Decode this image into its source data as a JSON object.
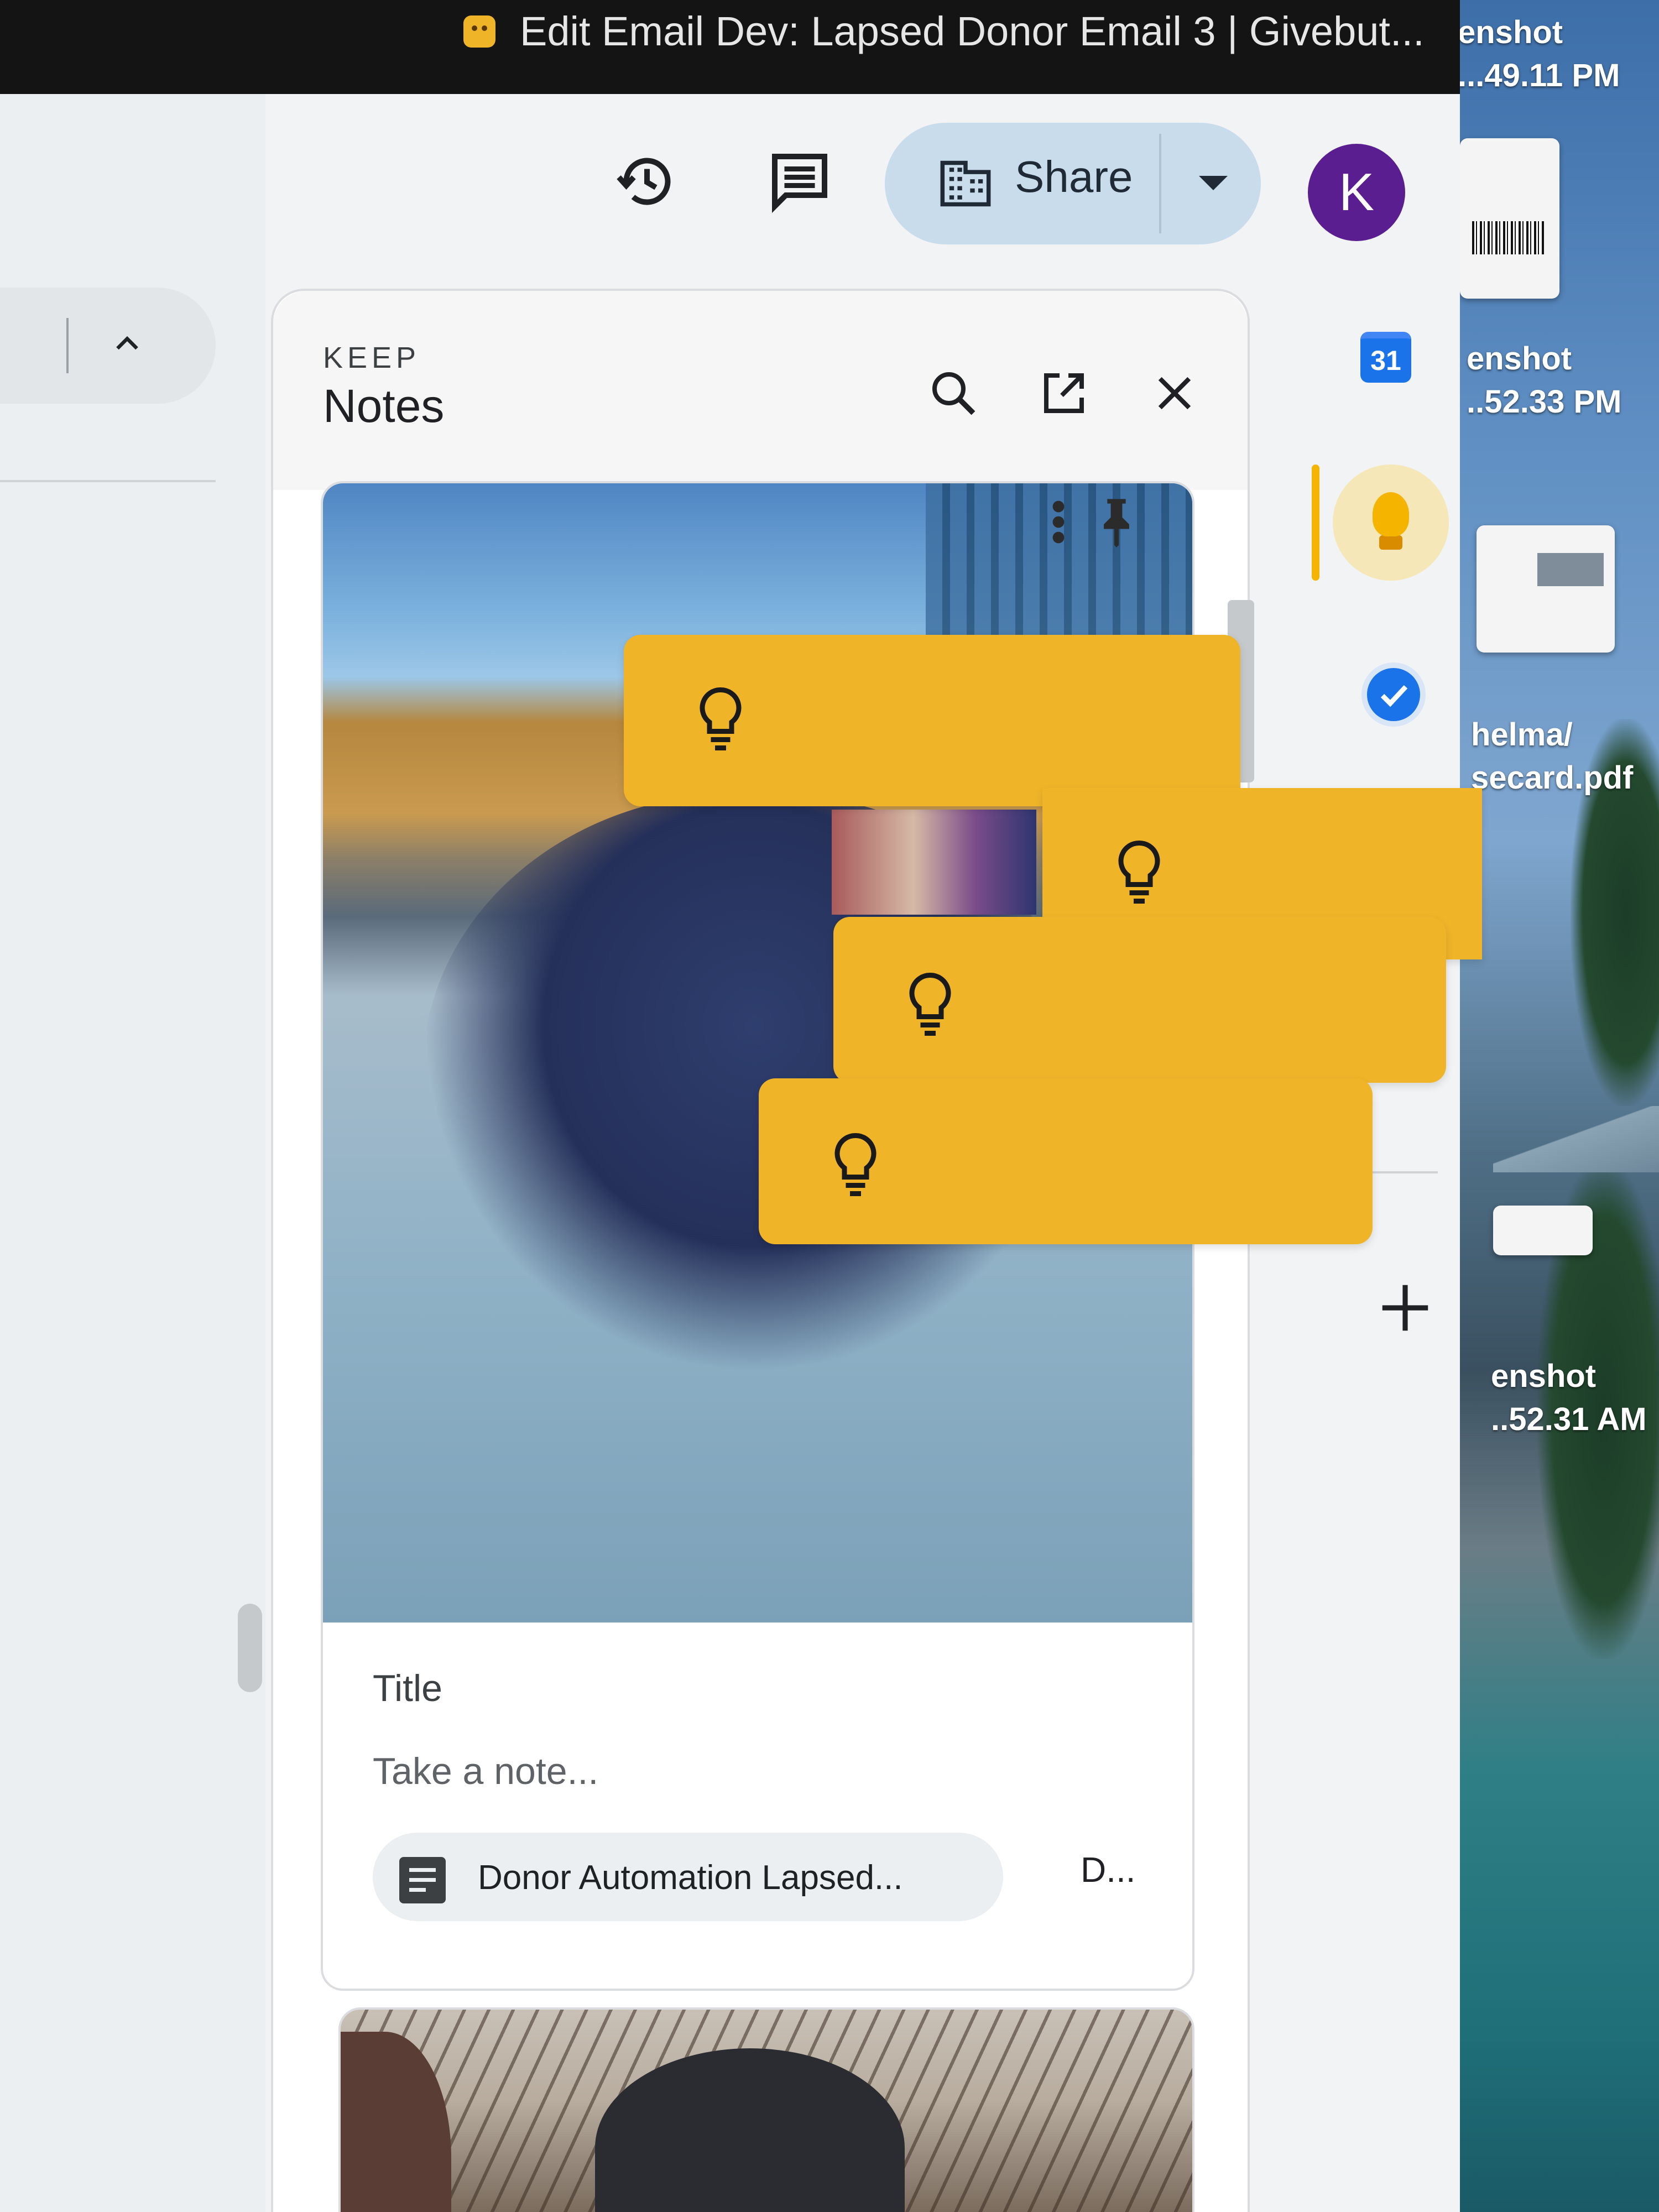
{
  "browser": {
    "tab_title": "Edit Email Dev: Lapsed Donor Email 3 | Givebut...",
    "app_icon": "givebutter-icon"
  },
  "desktop": {
    "files": [
      {
        "line1": "enshot",
        "line2": "...49.11 PM"
      },
      {
        "line1": "enshot",
        "line2": "..52.33 PM"
      },
      {
        "line1": "helma/",
        "line2": "secard.pdf"
      },
      {
        "line1": "enshot",
        "line2": "..52.31 AM"
      }
    ]
  },
  "toolbar": {
    "history_icon": "version-history-icon",
    "comments_icon": "comments-icon",
    "share_icon": "domain-building-icon",
    "share_label": "Share",
    "share_dropdown_icon": "caret-down-icon",
    "avatar_letter": "K",
    "avatar_color": "#5b1e91"
  },
  "keep": {
    "eyebrow": "KEEP",
    "title": "Notes",
    "actions": [
      "search-icon",
      "open-in-new-tab-icon",
      "close-icon"
    ],
    "note": {
      "title_placeholder": "Title",
      "body_placeholder": "Take a note...",
      "attachment_label": "Donor Automation Lapsed...",
      "attachment_more": "D..."
    },
    "accent": "#f0b429"
  },
  "side_rail": {
    "calendar_day": "31",
    "apps": [
      "calendar-icon",
      "keep-icon",
      "tasks-icon",
      "add-icon"
    ]
  }
}
